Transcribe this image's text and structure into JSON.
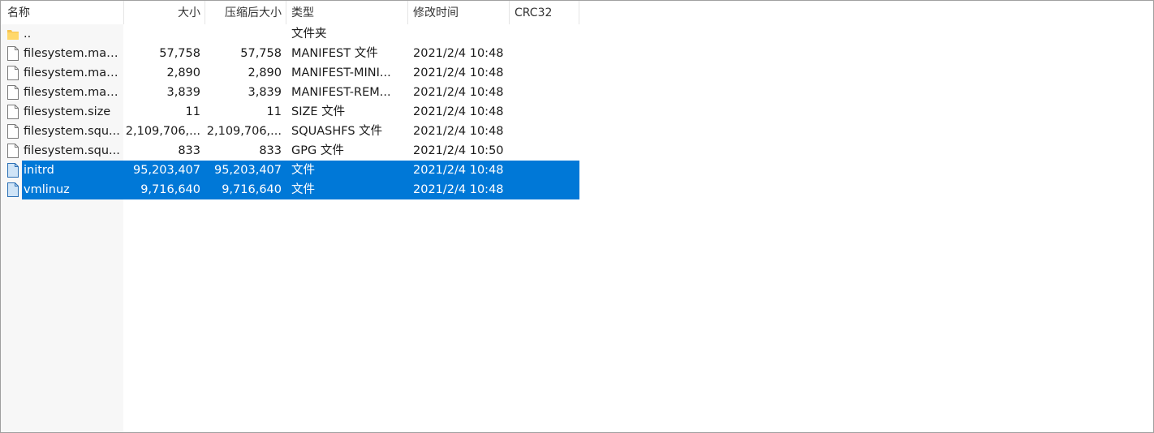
{
  "columns": {
    "name": "名称",
    "size": "大小",
    "packed": "压缩后大小",
    "type": "类型",
    "modified": "修改时间",
    "crc": "CRC32"
  },
  "rows": [
    {
      "icon": "folder-icon",
      "name": "..",
      "size": "",
      "packed": "",
      "type": "文件夹",
      "modified": "",
      "crc": "",
      "selected": false
    },
    {
      "icon": "file-icon",
      "name": "filesystem.man...",
      "size": "57,758",
      "packed": "57,758",
      "type": "MANIFEST 文件",
      "modified": "2021/2/4 10:48",
      "crc": "",
      "selected": false
    },
    {
      "icon": "file-icon",
      "name": "filesystem.man...",
      "size": "2,890",
      "packed": "2,890",
      "type": "MANIFEST-MINI...",
      "modified": "2021/2/4 10:48",
      "crc": "",
      "selected": false
    },
    {
      "icon": "file-icon",
      "name": "filesystem.man...",
      "size": "3,839",
      "packed": "3,839",
      "type": "MANIFEST-REM...",
      "modified": "2021/2/4 10:48",
      "crc": "",
      "selected": false
    },
    {
      "icon": "file-icon",
      "name": "filesystem.size",
      "size": "11",
      "packed": "11",
      "type": "SIZE 文件",
      "modified": "2021/2/4 10:48",
      "crc": "",
      "selected": false
    },
    {
      "icon": "file-icon",
      "name": "filesystem.squ...",
      "size": "2,109,706,...",
      "packed": "2,109,706,...",
      "type": "SQUASHFS 文件",
      "modified": "2021/2/4 10:48",
      "crc": "",
      "selected": false
    },
    {
      "icon": "file-icon",
      "name": "filesystem.squ...",
      "size": "833",
      "packed": "833",
      "type": "GPG 文件",
      "modified": "2021/2/4 10:50",
      "crc": "",
      "selected": false
    },
    {
      "icon": "file-icon",
      "name": "initrd",
      "size": "95,203,407",
      "packed": "95,203,407",
      "type": "文件",
      "modified": "2021/2/4 10:48",
      "crc": "",
      "selected": true
    },
    {
      "icon": "file-icon",
      "name": "vmlinuz",
      "size": "9,716,640",
      "packed": "9,716,640",
      "type": "文件",
      "modified": "2021/2/4 10:48",
      "crc": "",
      "selected": true
    }
  ]
}
